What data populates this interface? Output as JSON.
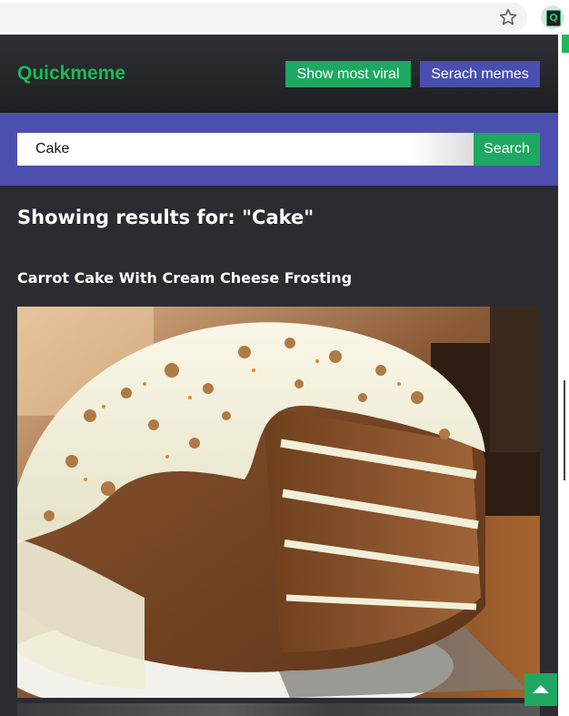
{
  "browser": {
    "star_icon": "star-outline-icon",
    "extension_icon": "quickmeme-extension-icon",
    "extension_letter": "Q"
  },
  "header": {
    "logo": "Quickmeme",
    "btn_viral": "Show most viral",
    "btn_search_memes": "Serach memes"
  },
  "search": {
    "value": "Cake",
    "button": "Search"
  },
  "results": {
    "heading": "Showing results for: \"Cake\"",
    "items": [
      {
        "title": "Carrot Cake With Cream Cheese Frosting",
        "image": "carrot-cake-photo"
      }
    ]
  },
  "scroll_top_icon": "chevron-up-icon",
  "colors": {
    "brand_green": "#1db954",
    "button_green": "#1fa861",
    "accent_purple": "#4c4fae",
    "background": "#2b2c31"
  }
}
